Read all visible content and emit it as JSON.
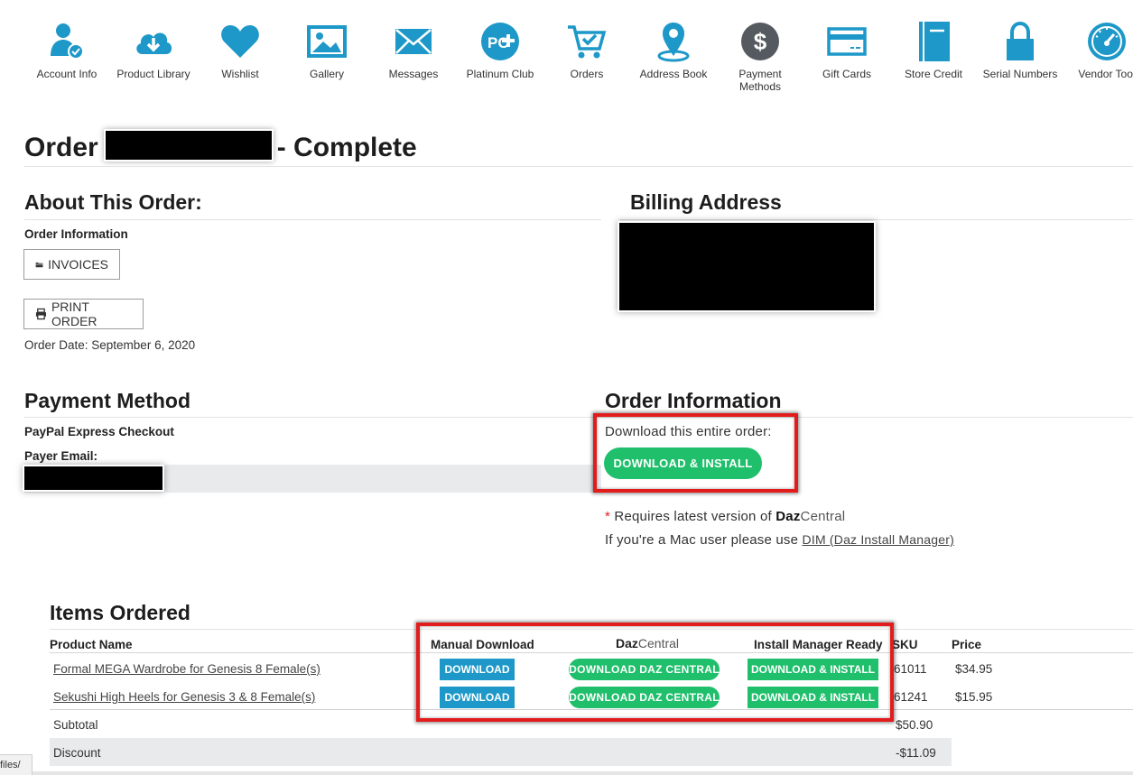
{
  "nav": {
    "items": [
      {
        "label": "Account Info",
        "icon": "account-info-icon"
      },
      {
        "label": "Product Library",
        "icon": "cloud-download-icon"
      },
      {
        "label": "Wishlist",
        "icon": "heart-icon"
      },
      {
        "label": "Gallery",
        "icon": "image-icon"
      },
      {
        "label": "Messages",
        "icon": "envelope-icon"
      },
      {
        "label": "Platinum Club",
        "icon": "platinum-club-icon"
      },
      {
        "label": "Orders",
        "icon": "cart-icon"
      },
      {
        "label": "Address Book",
        "icon": "map-pin-icon"
      },
      {
        "label": "Payment Methods",
        "icon": "dollar-icon"
      },
      {
        "label": "Gift Cards",
        "icon": "credit-card-icon"
      },
      {
        "label": "Store Credit",
        "icon": "book-icon"
      },
      {
        "label": "Serial Numbers",
        "icon": "lock-icon"
      },
      {
        "label": "Vendor Tool",
        "icon": "gauge-icon"
      }
    ],
    "icon_color": "#1d98c8"
  },
  "order": {
    "title_prefix": "Order",
    "title_suffix": "- Complete"
  },
  "about": {
    "heading": "About This Order:",
    "subheading": "Order Information",
    "invoices_label": "INVOICES",
    "print_label": "PRINT ORDER",
    "order_date": "Order Date: September 6, 2020"
  },
  "billing": {
    "heading": "Billing Address"
  },
  "payment": {
    "heading": "Payment Method",
    "method": "PayPal Express Checkout",
    "payer_label": "Payer Email:"
  },
  "order_info": {
    "heading": "Order Information",
    "download_text": "Download this entire order:",
    "download_button": "DOWNLOAD & INSTALL",
    "req_star": "*",
    "req_text": "Requires latest version of",
    "brand_bold": "Daz",
    "brand_light": "Central",
    "mac_text": "If you're a Mac user please use",
    "mac_link": "DIM (Daz Install Manager)"
  },
  "items": {
    "heading": "Items Ordered",
    "columns": {
      "product": "Product Name",
      "manual": "Manual Download",
      "daz_bold": "Daz",
      "daz_light": "Central",
      "dim": "Install Manager Ready",
      "sku": "SKU",
      "price": "Price"
    },
    "rows": [
      {
        "name": "Formal MEGA Wardrobe for Genesis 8 Female(s)",
        "download": "DOWNLOAD",
        "daz_central": "DOWNLOAD DAZ CENTRAL",
        "install": "DOWNLOAD & INSTALL",
        "sku": "61011",
        "price": "$34.95"
      },
      {
        "name": "Sekushi High Heels for Genesis 3 & 8 Female(s)",
        "download": "DOWNLOAD",
        "daz_central": "DOWNLOAD DAZ CENTRAL",
        "install": "DOWNLOAD & INSTALL",
        "sku": "61241",
        "price": "$15.95"
      }
    ],
    "subtotal_label": "Subtotal",
    "subtotal_value": "$50.90",
    "discount_label": "Discount",
    "discount_value": "-$11.09"
  },
  "status_bar": {
    "url_fragment": "files/"
  },
  "colors": {
    "accent_blue": "#1d98c8",
    "accent_green": "#1fbf6b",
    "highlight_red": "#e21c1c"
  }
}
